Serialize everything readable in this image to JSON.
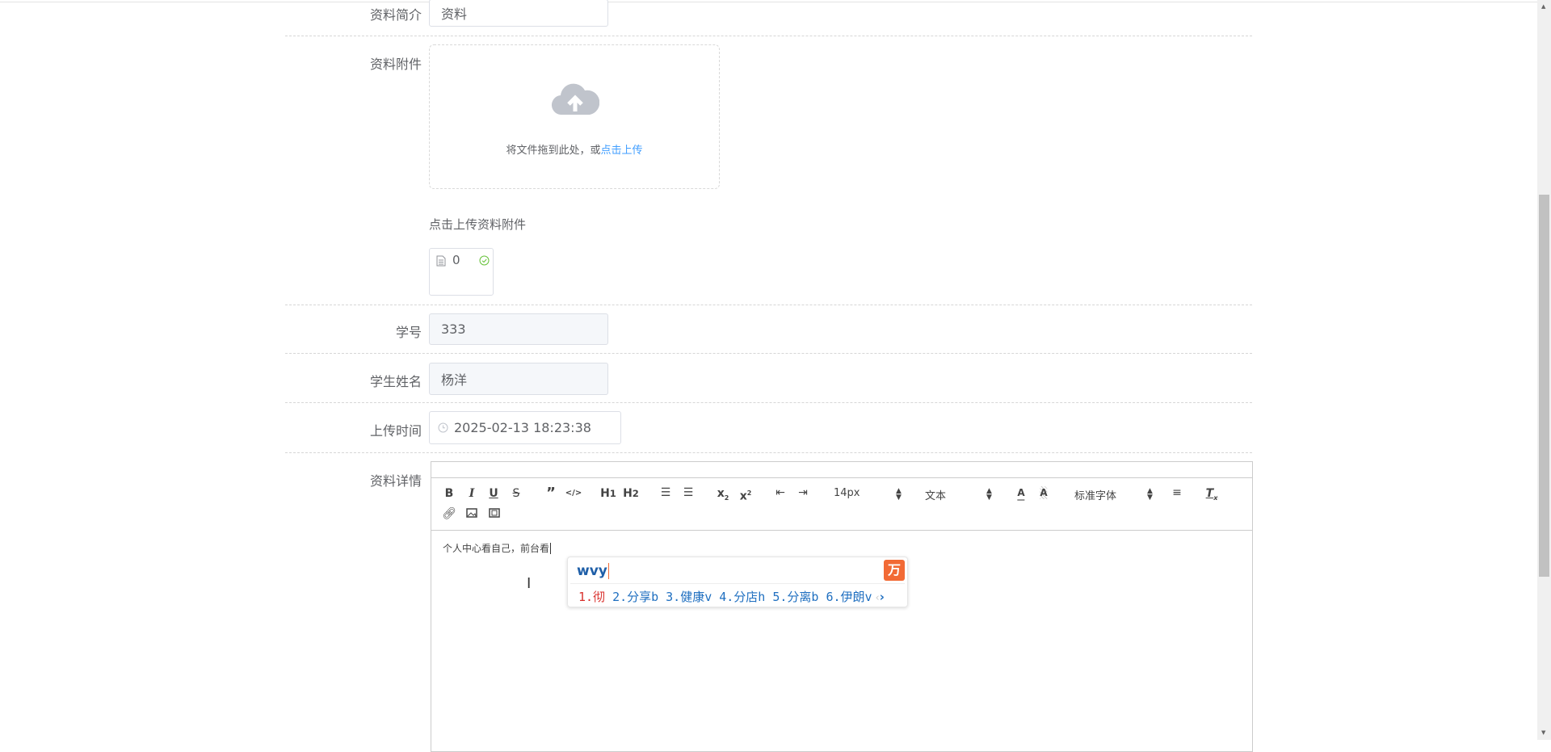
{
  "form": {
    "summary": {
      "label": "资料简介",
      "value": "资料"
    },
    "attachment": {
      "label": "资料附件",
      "drop_text": "将文件拖到此处，或",
      "drop_link": "点击上传",
      "tip": "点击上传资料附件",
      "file_name": "0",
      "upload_icon": "cloud-upload-icon",
      "file_icon": "document-icon",
      "status_icon": "check-circle-icon"
    },
    "student_id": {
      "label": "学号",
      "value": "333"
    },
    "student_name": {
      "label": "学生姓名",
      "value": "杨洋"
    },
    "upload_time": {
      "label": "上传时间",
      "value": "2025-02-13 18:23:38",
      "icon": "clock-icon"
    },
    "detail": {
      "label": "资料详情",
      "content": "个人中心看自己，前台看",
      "toolbar": {
        "font_size": "14px",
        "header": "文本",
        "font_family": "标准字体"
      }
    }
  },
  "ime": {
    "input": "wvy",
    "candidates": [
      "1.彻",
      "2.分享b",
      "3.健康v",
      "4.分店h",
      "5.分离b",
      "6.伊朗v"
    ],
    "highlight_color": "#d9302c",
    "candidate_color": "#1f6fc0",
    "logo_color": "#f26a35"
  }
}
